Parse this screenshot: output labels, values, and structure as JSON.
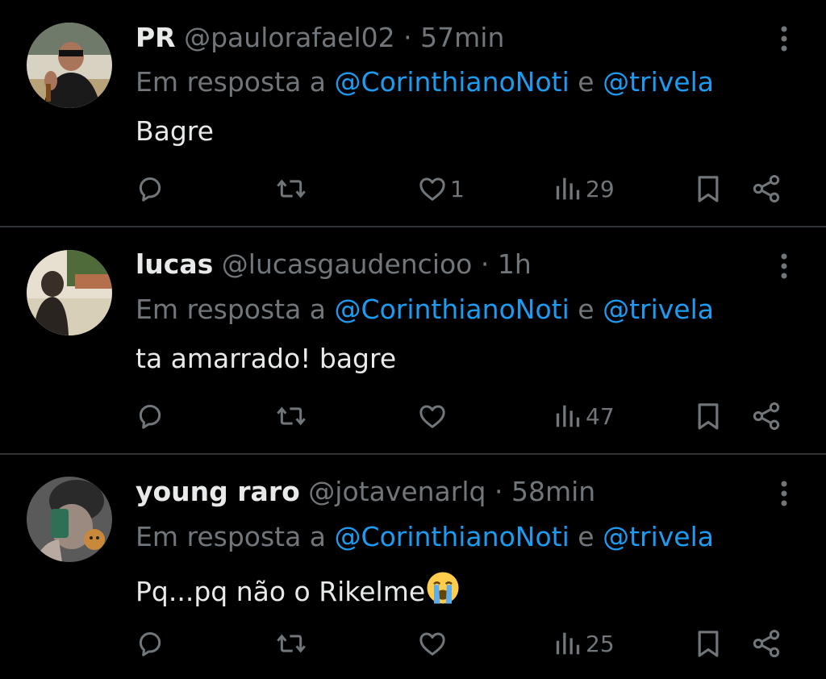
{
  "colors": {
    "background": "#000000",
    "primary_text": "#e7e9ea",
    "secondary_text": "#71767b",
    "mention": "#1d9bf0",
    "divider": "#2f3336"
  },
  "tweets": [
    {
      "display_name": "PR",
      "handle": "@paulorafael02",
      "separator": "·",
      "time": "57min",
      "reply_prefix": "Em resposta a",
      "reply_mention_1": "@CorinthianoNoti",
      "reply_and": "e",
      "reply_mention_2": "@trivela",
      "text": "Bagre",
      "likes": "1",
      "views": "29",
      "icons": [
        "reply-icon",
        "retweet-icon",
        "heart-icon",
        "views-icon",
        "bookmark-icon",
        "share-icon"
      ]
    },
    {
      "display_name": "lucas",
      "handle": "@lucasgaudencioo",
      "separator": "·",
      "time": "1h",
      "reply_prefix": "Em resposta a",
      "reply_mention_1": "@CorinthianoNoti",
      "reply_and": "e",
      "reply_mention_2": "@trivela",
      "text": "ta amarrado! bagre",
      "likes": "",
      "views": "47",
      "icons": [
        "reply-icon",
        "retweet-icon",
        "heart-icon",
        "views-icon",
        "bookmark-icon",
        "share-icon"
      ]
    },
    {
      "display_name": "young raro",
      "handle": "@jotavenarlq",
      "separator": "·",
      "time": "58min",
      "reply_prefix": "Em resposta a",
      "reply_mention_1": "@CorinthianoNoti",
      "reply_and": "e",
      "reply_mention_2": "@trivela",
      "text": "Pq...pq não o Rikelme",
      "emoji": "loudly-crying-face-icon",
      "likes": "",
      "views": "25",
      "icons": [
        "reply-icon",
        "retweet-icon",
        "heart-icon",
        "views-icon",
        "bookmark-icon",
        "share-icon"
      ]
    }
  ]
}
